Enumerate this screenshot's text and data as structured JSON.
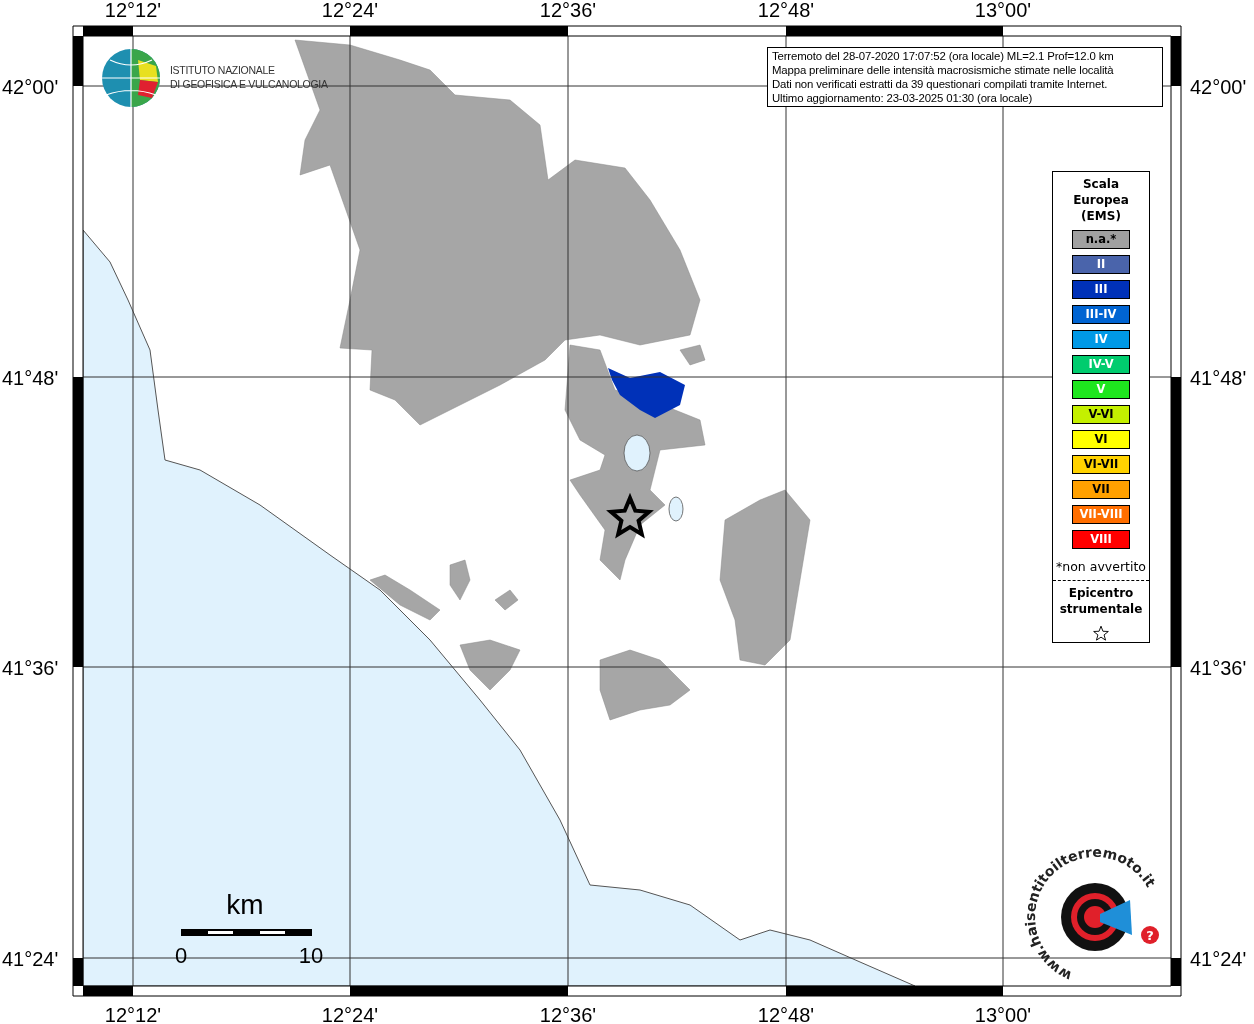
{
  "axes": {
    "top": [
      "12°12'",
      "12°24'",
      "12°36'",
      "12°48'",
      "13°00'"
    ],
    "bottom": [
      "12°12'",
      "12°24'",
      "12°36'",
      "12°48'",
      "13°00'"
    ],
    "left": [
      "42°00'",
      "41°48'",
      "41°36'",
      "41°24'"
    ],
    "right": [
      "42°00'",
      "41°48'",
      "41°36'",
      "41°24'"
    ]
  },
  "institute_logo": {
    "lines": [
      "ISTITUTO NAZIONALE",
      "DI GEOFISICA E VULCANOLOGIA"
    ]
  },
  "info_box": {
    "lines": [
      "Terremoto del 28-07-2020 17:07:52 (ora locale) ML=2.1 Prof=12.0 km",
      "Mappa preliminare delle intensità macrosismiche stimate nelle località",
      "Dati non verificati estratti da 39 questionari compilati tramite Internet.",
      "Ultimo aggiornamento: 23-03-2025 01:30 (ora locale)"
    ]
  },
  "legend": {
    "title": [
      "Scala",
      "Europea",
      "(EMS)"
    ],
    "items": [
      {
        "label": "n.a.*",
        "color": "#a0a0a0"
      },
      {
        "label": "II",
        "color": "#4a64ab"
      },
      {
        "label": "III",
        "color": "#0031b8"
      },
      {
        "label": "III-IV",
        "color": "#0064d2"
      },
      {
        "label": "IV",
        "color": "#0099e6"
      },
      {
        "label": "IV-V",
        "color": "#00cc6e"
      },
      {
        "label": "V",
        "color": "#1ee61e"
      },
      {
        "label": "V-VI",
        "color": "#c4f000"
      },
      {
        "label": "VI",
        "color": "#ffff00"
      },
      {
        "label": "VI-VII",
        "color": "#ffd200"
      },
      {
        "label": "VII",
        "color": "#ffa000"
      },
      {
        "label": "VII-VIII",
        "color": "#ff6e00"
      },
      {
        "label": "VIII",
        "color": "#ff0000"
      }
    ],
    "footnote": "*non avvertito",
    "epicenter_title": [
      "Epicentro",
      "strumentale"
    ]
  },
  "scale_bar": {
    "unit": "km",
    "start": "0",
    "end": "10"
  },
  "site_logo": {
    "ring_text": "www.haisentitoilterremoto.it",
    "badge": "?"
  }
}
